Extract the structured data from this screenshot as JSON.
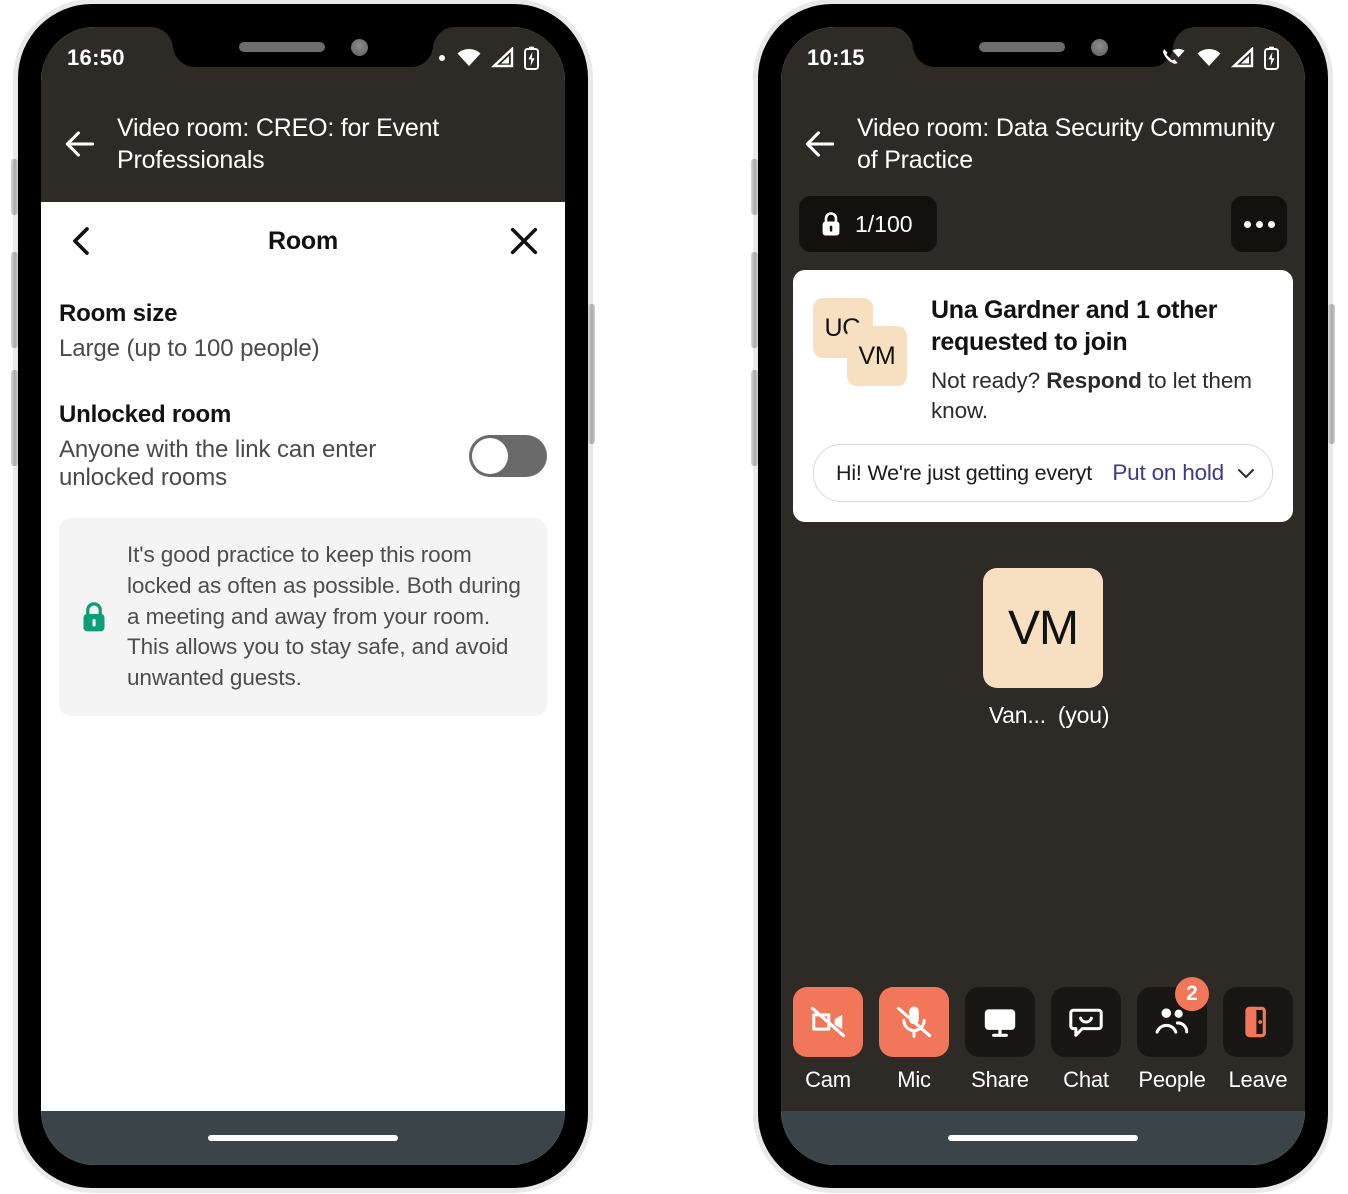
{
  "theme": {
    "header_bg": "#2e2a26",
    "accent_orange": "#f2775a",
    "avatar_bg": "#f7dfc2",
    "link_indigo": "#3b3a8f",
    "lock_green": "#0f9d77",
    "navbar": "#3b4449"
  },
  "left_phone": {
    "status": {
      "time": "16:50",
      "icons": [
        "dot-indicator",
        "wifi-icon",
        "cell-signal-icon",
        "battery-charging-icon"
      ]
    },
    "header": {
      "back_icon": "back-arrow-icon",
      "title": "Video room: CREO: for Event Professionals"
    },
    "sheet": {
      "back_icon": "chevron-left-icon",
      "title": "Room",
      "close_icon": "close-x-icon",
      "fields": [
        {
          "label": "Room size",
          "value": "Large (up to 100 people)"
        },
        {
          "label": "Unlocked room",
          "value": "Anyone with the link can enter unlocked rooms"
        }
      ],
      "toggle": {
        "name": "unlocked-room-toggle",
        "state": "off"
      },
      "notice": {
        "icon": "lock-icon",
        "text": "It's good practice to keep this room locked as often as possible. Both during a meeting and away from your room. This allows you to stay safe, and avoid unwanted guests."
      }
    }
  },
  "right_phone": {
    "status": {
      "time": "10:15",
      "icons": [
        "phone-wifi-calling-icon",
        "wifi-icon",
        "cell-signal-icon",
        "battery-charging-icon"
      ]
    },
    "header": {
      "back_icon": "back-arrow-icon",
      "title": "Video room: Data Security Community of Practice"
    },
    "topbar": {
      "lock_icon": "lock-icon",
      "capacity": "1/100",
      "more_icon": "more-horizontal-icon"
    },
    "notification": {
      "avatars": [
        "UG",
        "VM"
      ],
      "heading": "Una Gardner and 1 other requested to join",
      "sub_prefix": "Not ready? ",
      "sub_bold": "Respond",
      "sub_suffix": " to let them know.",
      "reply_text": "Hi! We're just getting everyt",
      "reply_action": "Put on hold",
      "chevron_icon": "chevron-down-icon"
    },
    "participant": {
      "initials": "VM",
      "name": "Van...",
      "you_label": "(you)"
    },
    "controls": [
      {
        "label": "Cam",
        "icon": "camera-off-icon",
        "state": "active-off",
        "badge": ""
      },
      {
        "label": "Mic",
        "icon": "mic-off-icon",
        "state": "active-off",
        "badge": ""
      },
      {
        "label": "Share",
        "icon": "screen-share-icon",
        "state": "default",
        "badge": ""
      },
      {
        "label": "Chat",
        "icon": "chat-bubble-icon",
        "state": "default",
        "badge": ""
      },
      {
        "label": "People",
        "icon": "people-icon",
        "state": "default",
        "badge": "2"
      },
      {
        "label": "Leave",
        "icon": "leave-door-icon",
        "state": "default",
        "badge": ""
      }
    ]
  }
}
